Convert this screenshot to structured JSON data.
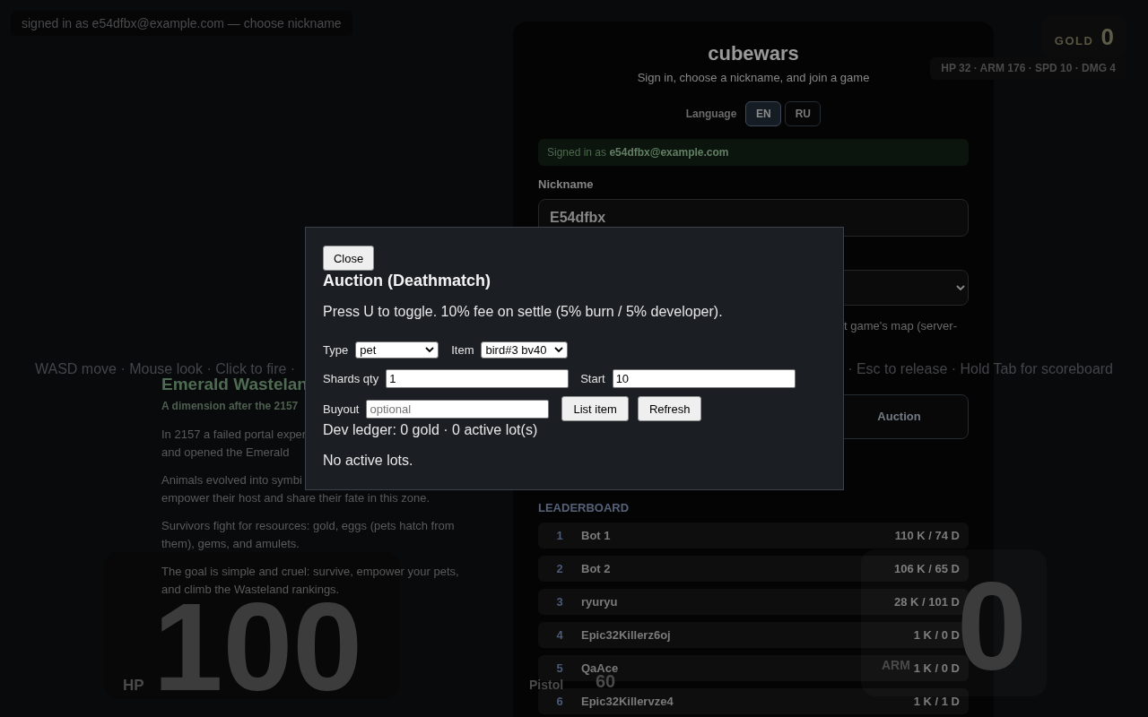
{
  "hud": {
    "status": "signed in as e54dfbx@example.com — choose nickname",
    "wallet": {
      "label": "GOLD",
      "value": "0"
    },
    "stats": "HP 32 · ARM 176 · SPD 10 · DMG 4",
    "controls_hint": {
      "left": "WASD move · Mouse look · Click to fire ·",
      "right": "· Esc to release · Hold Tab for scoreboard"
    },
    "hp": {
      "label": "HP",
      "value": "100"
    },
    "armor": {
      "label": "ARM",
      "value": "0"
    },
    "weapon": {
      "name": "Pistol",
      "ammo": "60"
    }
  },
  "lore": {
    "title": "Emerald Wastelan",
    "subtitle": "A dimension after the 2157",
    "paragraphs": [
      [
        "In 2157 a failed portal exper",
        "and opened the Emerald"
      ],
      [
        "Animals evolved into symbi",
        "empower their host and share their fate in this zone."
      ],
      [
        "Survivors fight for resources: gold, eggs (pets hatch from",
        "them), gems, and amulets."
      ],
      [
        "The goal is simple and cruel: survive, empower your pets,",
        "and climb the Wasteland rankings."
      ]
    ]
  },
  "login": {
    "title": "cubewars",
    "subtitle": "Sign in, choose a nickname, and join a game",
    "language": {
      "label": "Language",
      "options": [
        {
          "label": "EN",
          "selected": true
        },
        {
          "label": "RU",
          "selected": false
        }
      ]
    },
    "signed_in": "Signed in as **e54dfbx@example.com**",
    "nickname": {
      "label": "Nickname",
      "value": "E54dfbx"
    },
    "map_note": "t game's map (server-",
    "auction_button": "Auction",
    "leaderboard": {
      "title": "LEADERBOARD",
      "rows": [
        {
          "rank": "1",
          "name": "Bot 1",
          "score": "110 K / 74 D"
        },
        {
          "rank": "2",
          "name": "Bot 2",
          "score": "106 K / 65 D"
        },
        {
          "rank": "3",
          "name": "ryuryu",
          "score": "28 K / 101 D"
        },
        {
          "rank": "4",
          "name": "Epic32Killerz6oj",
          "score": "1 K / 0 D"
        },
        {
          "rank": "5",
          "name": "QaAce",
          "score": "1 K / 0 D"
        },
        {
          "rank": "6",
          "name": "Epic32Killervze4",
          "score": "1 K / 1 D"
        }
      ]
    }
  },
  "modal": {
    "close": "Close",
    "title": "Auction (Deathmatch)",
    "note": "Press U to toggle. 10% fee on settle (5% burn / 5% developer).",
    "type": {
      "label": "Type",
      "value": "pet"
    },
    "item": {
      "label": "Item",
      "value": "bird#3 bv40"
    },
    "shards": {
      "label": "Shards qty",
      "value": "1"
    },
    "start": {
      "label": "Start",
      "value": "10"
    },
    "buyout": {
      "label": "Buyout",
      "placeholder": "optional"
    },
    "buttons": [
      "List item",
      "Refresh"
    ],
    "ledger": "Dev ledger: 0 gold · 0 active lot(s)",
    "empty": "No active lots."
  }
}
